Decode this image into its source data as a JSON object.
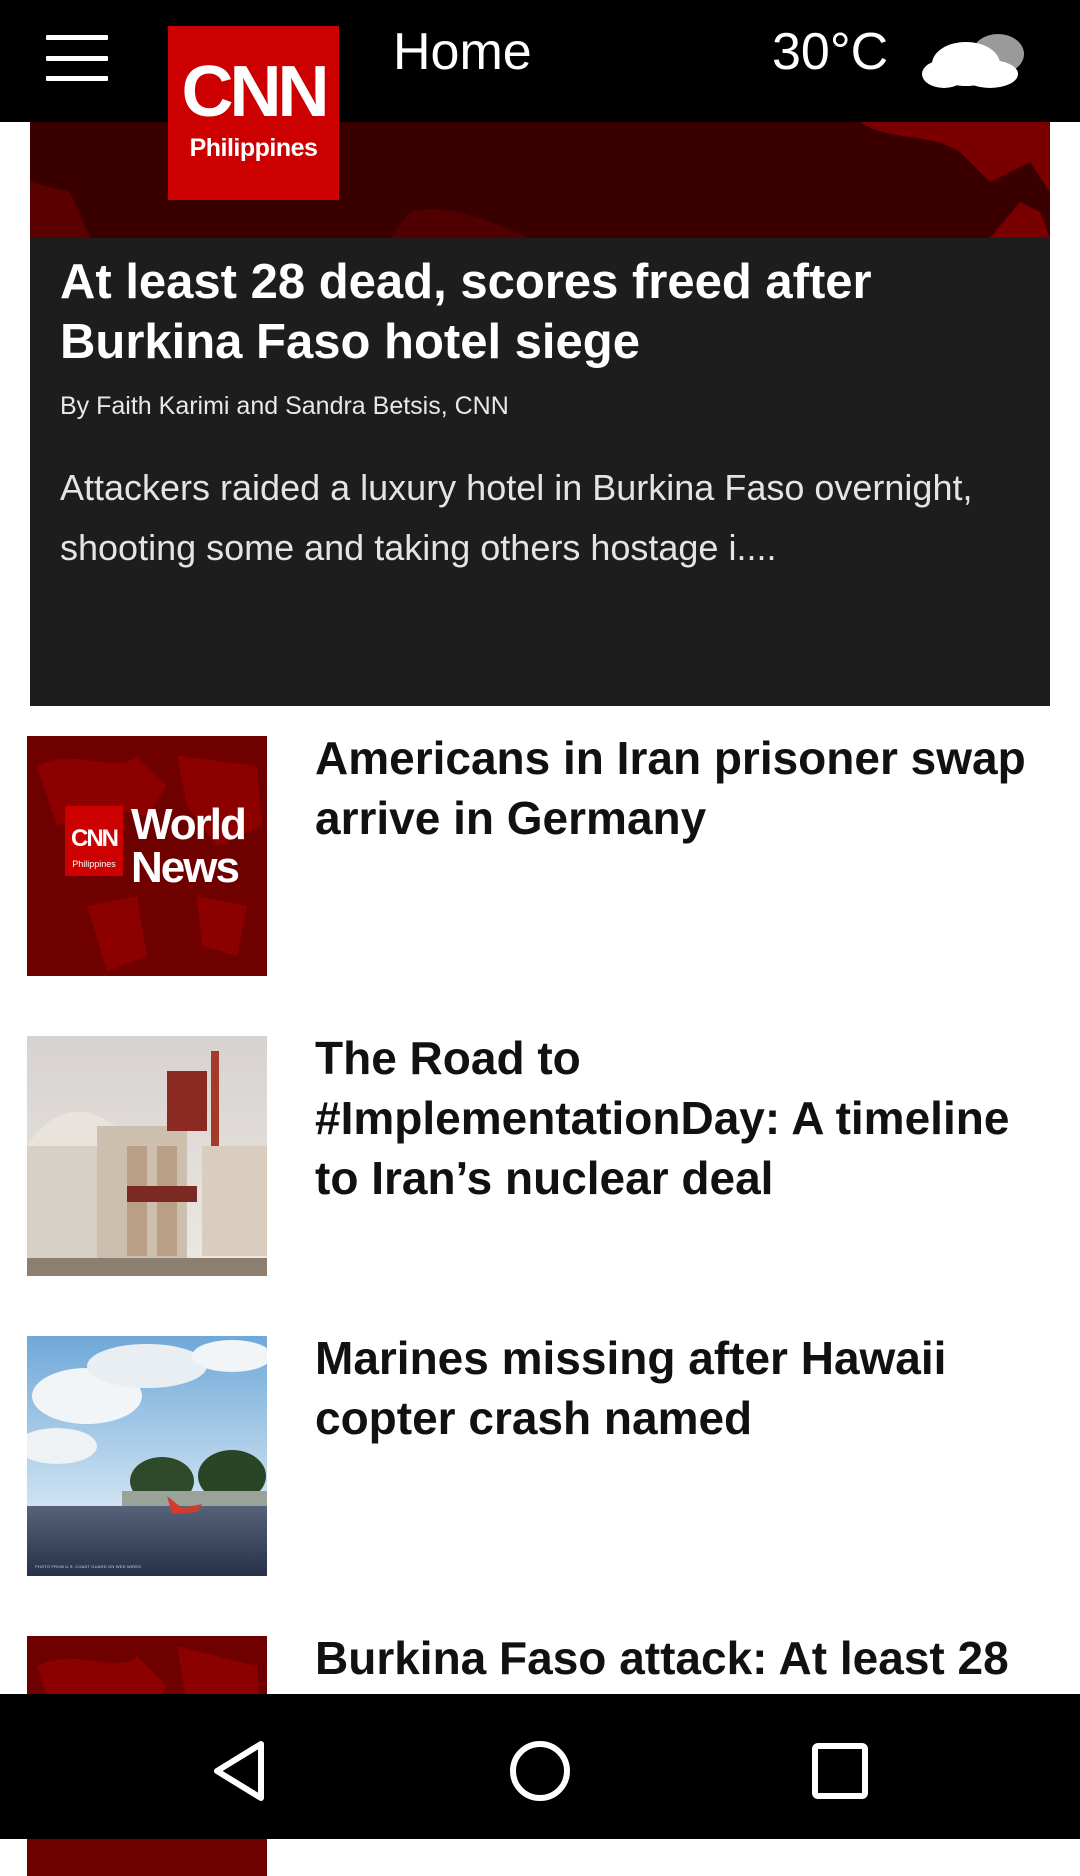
{
  "header": {
    "menu_icon": "hamburger-menu-icon",
    "logo": {
      "brand": "CNN",
      "region": "Philippines"
    },
    "title": "Home",
    "temperature": "30°C",
    "weather_icon": "partly-cloudy-icon"
  },
  "featured": {
    "title": "At least 28 dead, scores freed after Burkina Faso hotel siege",
    "byline": "By Faith Karimi and Sandra Betsis, CNN",
    "summary": "Attackers raided a luxury hotel in Burkina Faso overnight, shooting some and taking others hostage i...."
  },
  "news": [
    {
      "title": "Americans in Iran prisoner swap arrive in Germany",
      "thumb_logo": {
        "brand": "CNN",
        "region": "Philippines",
        "label_line1": "World",
        "label_line2": "News"
      }
    },
    {
      "title": "The Road to #ImplementationDay: A timeline to Iran’s nuclear deal"
    },
    {
      "title": "Marines missing after Hawaii copter crash named",
      "thumb_caption": "PHOTO FROM U.S. COAST GUARD ON WED WIRES"
    },
    {
      "title": "Burkina Faso attack: At least 28"
    }
  ],
  "navbar": {
    "back_icon": "back-triangle-icon",
    "home_icon": "home-circle-icon",
    "recents_icon": "recents-square-icon"
  },
  "colors": {
    "brand_red": "#cc0000",
    "header_bg": "#000000",
    "featured_bg": "#1d1d1d"
  }
}
